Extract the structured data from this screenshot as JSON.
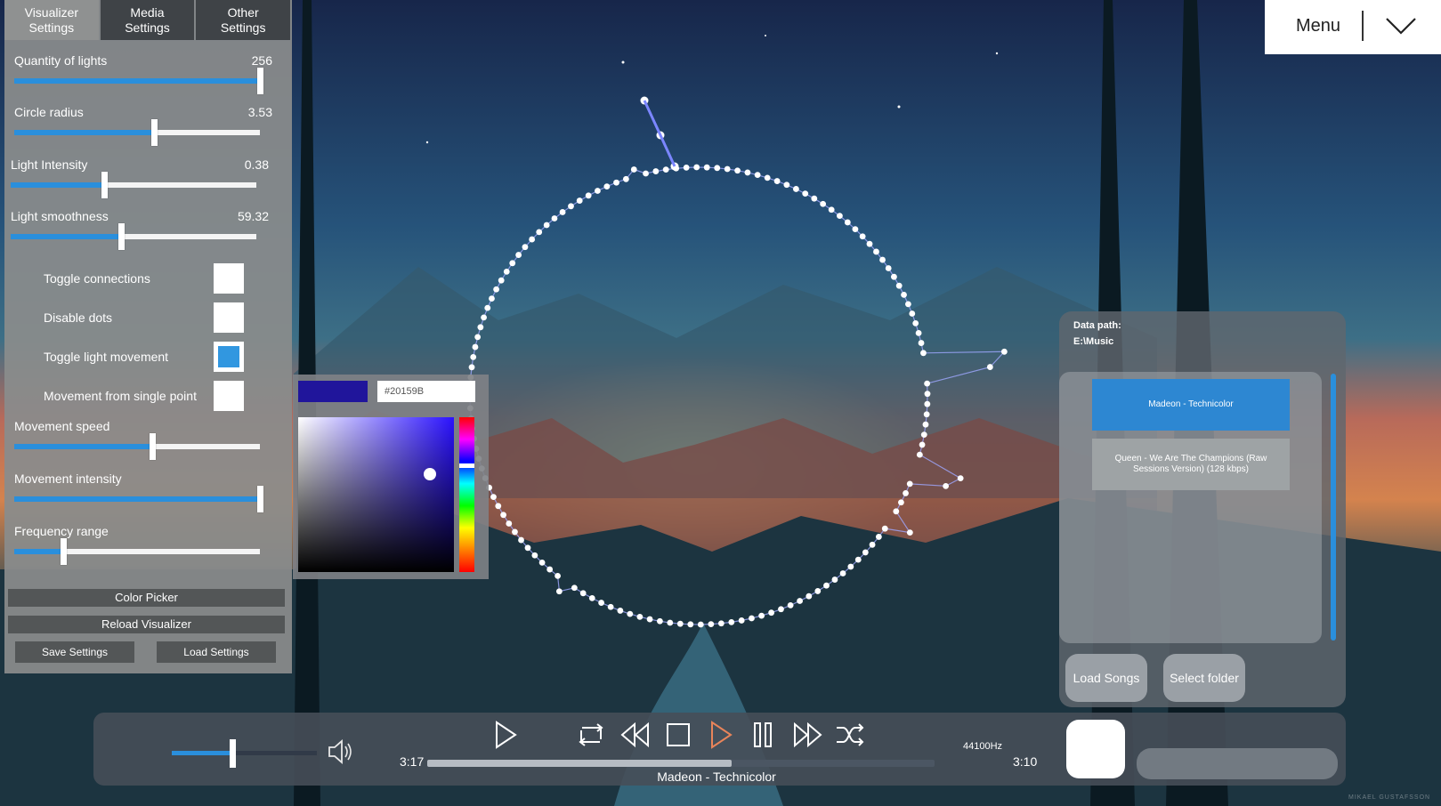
{
  "tabs": [
    "Visualizer\nSettings",
    "Media\nSettings",
    "Other\nSettings"
  ],
  "sliders": [
    {
      "label": "Quantity of lights",
      "value": "256",
      "fraction": 1.0
    },
    {
      "label": "Circle radius",
      "value": "3.53",
      "fraction": 0.57
    },
    {
      "label": "Light Intensity",
      "value": "0.38",
      "fraction": 0.38
    },
    {
      "label": "Light smoothness",
      "value": "59.32",
      "fraction": 0.45
    }
  ],
  "toggles": [
    {
      "label": "Toggle connections",
      "checked": false
    },
    {
      "label": "Disable dots",
      "checked": false
    },
    {
      "label": "Toggle light movement",
      "checked": true
    },
    {
      "label": "Movement from single point",
      "checked": false
    }
  ],
  "sliders2": [
    {
      "label": "Movement speed",
      "fraction": 0.56
    },
    {
      "label": "Movement intensity",
      "fraction": 1.0
    },
    {
      "label": "Frequency range",
      "fraction": 0.2
    }
  ],
  "buttons": {
    "color_picker": "Color Picker",
    "reload_visualizer": "Reload Visualizer",
    "save_settings": "Save Settings",
    "load_settings": "Load Settings"
  },
  "color_picker": {
    "hex": "#20159B",
    "swatch_color": "#20159B"
  },
  "menu": {
    "label": "Menu",
    "icon": "chevron-down-icon"
  },
  "playlist": {
    "data_path_label": "Data path:",
    "data_path_value": "E:\\Music",
    "songs": [
      {
        "title": "Madeon - Technicolor",
        "selected": true
      },
      {
        "title": "Queen - We Are The Champions (Raw Sessions Version) (128  kbps)",
        "selected": false
      }
    ],
    "load_songs": "Load Songs",
    "select_folder": "Select folder"
  },
  "transport": {
    "volume_fraction": 0.4,
    "elapsed": "3:17",
    "total": "3:10",
    "progress_fraction": 0.6,
    "now_playing": "Madeon - Technicolor",
    "sample_rate": "44100Hz",
    "controls": [
      "play-icon",
      "repeat-icon",
      "rewind-icon",
      "stop-icon",
      "play-icon",
      "pause-icon",
      "fast-forward-icon",
      "shuffle-icon"
    ]
  },
  "colors": {
    "accent": "#2A8FDC",
    "panel": "#8A8C8C"
  },
  "watermark": "MIKAEL GUSTAFSSON"
}
